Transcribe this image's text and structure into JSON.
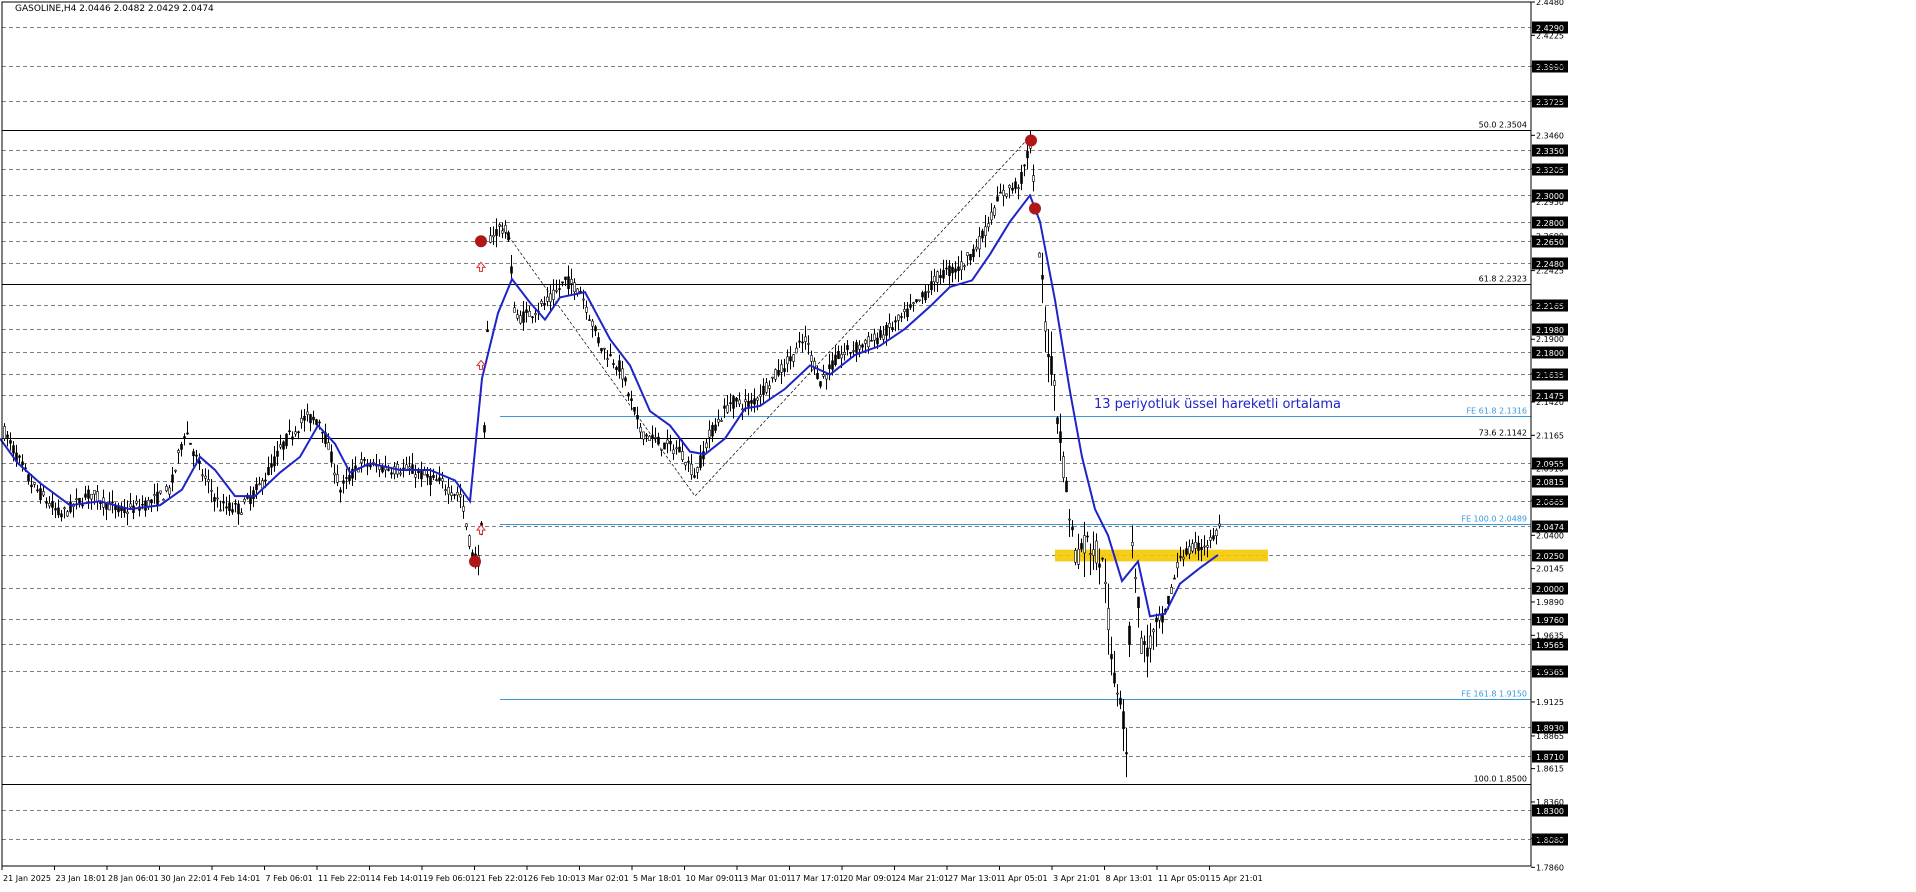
{
  "symbol_label": "GASOLINE,H4  2.0446 2.0482 2.0429 2.0474",
  "annotation_text": "13 periyotluk üssel hareketli ortalama",
  "colors": {
    "background": "#ffffff",
    "axis": "#000000",
    "grid_dashed": "#000000",
    "candle": "#000000",
    "ema": "#1f24c8",
    "fib_line": "#000000",
    "fe_line": "#3a9ad9",
    "marker_red": "#b01818",
    "arrow_red": "#e03030",
    "highlight": "#f5c800",
    "price_box": "#000000"
  },
  "chart_data": {
    "type": "candlestick",
    "title": "GASOLINE,H4",
    "ohlc_last": {
      "open": 2.0446,
      "high": 2.0482,
      "low": 2.0429,
      "close": 2.0474
    },
    "ylim": [
      1.787,
      2.448
    ],
    "x_tick_labels": [
      "21 Jan 2025",
      "23 Jan 18:01",
      "28 Jan 06:01",
      "30 Jan 22:01",
      "4 Feb 14:01",
      "7 Feb 06:01",
      "11 Feb 22:01",
      "14 Feb 14:01",
      "19 Feb 06:01",
      "21 Feb 22:01",
      "26 Feb 10:01",
      "3 Mar 02:01",
      "5 Mar 18:01",
      "10 Mar 09:01",
      "13 Mar 01:01",
      "17 Mar 17:01",
      "20 Mar 09:01",
      "24 Mar 21:01",
      "27 Mar 13:01",
      "1 Apr 05:01",
      "3 Apr 21:01",
      "8 Apr 13:01",
      "11 Apr 05:01",
      "15 Apr 21:01"
    ],
    "y_tick_labels": [
      "2.4480",
      "2.4225",
      "2.3990",
      "2.3725",
      "2.3460",
      "2.3205",
      "2.2950",
      "2.2690",
      "2.2425",
      "2.2165",
      "2.1900",
      "2.1635",
      "2.1420",
      "2.1165",
      "2.0910",
      "2.0665",
      "2.0400",
      "2.0145",
      "1.9890",
      "1.9635",
      "1.9375",
      "1.9125",
      "1.8865",
      "1.8615",
      "1.8360",
      "1.8080",
      "1.7860"
    ],
    "highlighted_levels": [
      "2.4290",
      "2.3990",
      "2.3725",
      "2.3350",
      "2.3205",
      "2.3000",
      "2.2800",
      "2.2650",
      "2.2480",
      "2.2165",
      "2.1980",
      "2.1800",
      "2.1635",
      "2.1475",
      "2.0955",
      "2.0815",
      "2.0665",
      "2.0474",
      "2.0250",
      "2.0000",
      "1.9760",
      "1.9565",
      "1.9365",
      "1.8930",
      "1.8710",
      "1.8300",
      "1.8080"
    ],
    "fibonacci_levels": [
      {
        "label": "50.0 2.3504",
        "value": 2.3504
      },
      {
        "label": "61.8 2.2323",
        "value": 2.2323
      },
      {
        "label": "73.6 2.1142",
        "value": 2.1142
      },
      {
        "label": "100.0 1.8500",
        "value": 1.85
      }
    ],
    "fibonacci_expansion_levels": [
      {
        "label": "FE 61.8 2.1316",
        "value": 2.1316
      },
      {
        "label": "FE 100.0 2.0489",
        "value": 2.0489
      },
      {
        "label": "FE 161.8 1.9150",
        "value": 1.915
      }
    ],
    "ema_period": 13,
    "ema_points": [
      [
        0,
        2.114
      ],
      [
        18,
        2.095
      ],
      [
        40,
        2.08
      ],
      [
        70,
        2.063
      ],
      [
        100,
        2.066
      ],
      [
        130,
        2.06
      ],
      [
        160,
        2.063
      ],
      [
        182,
        2.075
      ],
      [
        200,
        2.1
      ],
      [
        215,
        2.09
      ],
      [
        235,
        2.07
      ],
      [
        255,
        2.07
      ],
      [
        280,
        2.088
      ],
      [
        300,
        2.1
      ],
      [
        318,
        2.124
      ],
      [
        335,
        2.11
      ],
      [
        350,
        2.088
      ],
      [
        370,
        2.095
      ],
      [
        400,
        2.09
      ],
      [
        430,
        2.09
      ],
      [
        455,
        2.082
      ],
      [
        470,
        2.066
      ],
      [
        482,
        2.16
      ],
      [
        498,
        2.21
      ],
      [
        512,
        2.236
      ],
      [
        530,
        2.218
      ],
      [
        545,
        2.205
      ],
      [
        560,
        2.222
      ],
      [
        585,
        2.226
      ],
      [
        610,
        2.19
      ],
      [
        630,
        2.17
      ],
      [
        650,
        2.135
      ],
      [
        670,
        2.124
      ],
      [
        690,
        2.104
      ],
      [
        705,
        2.102
      ],
      [
        725,
        2.114
      ],
      [
        745,
        2.137
      ],
      [
        760,
        2.139
      ],
      [
        785,
        2.152
      ],
      [
        810,
        2.17
      ],
      [
        830,
        2.163
      ],
      [
        855,
        2.178
      ],
      [
        880,
        2.185
      ],
      [
        905,
        2.198
      ],
      [
        930,
        2.215
      ],
      [
        950,
        2.23
      ],
      [
        972,
        2.235
      ],
      [
        990,
        2.255
      ],
      [
        1010,
        2.28
      ],
      [
        1030,
        2.3
      ],
      [
        1040,
        2.28
      ],
      [
        1055,
        2.22
      ],
      [
        1070,
        2.15
      ],
      [
        1082,
        2.1
      ],
      [
        1095,
        2.06
      ],
      [
        1108,
        2.04
      ],
      [
        1122,
        2.005
      ],
      [
        1138,
        2.02
      ],
      [
        1150,
        1.978
      ],
      [
        1165,
        1.98
      ],
      [
        1180,
        2.003
      ],
      [
        1200,
        2.015
      ],
      [
        1218,
        2.025
      ]
    ],
    "price_points": [
      [
        0,
        2.125
      ],
      [
        30,
        2.08
      ],
      [
        60,
        2.055
      ],
      [
        90,
        2.072
      ],
      [
        120,
        2.058
      ],
      [
        150,
        2.065
      ],
      [
        170,
        2.075
      ],
      [
        185,
        2.122
      ],
      [
        200,
        2.09
      ],
      [
        220,
        2.062
      ],
      [
        240,
        2.06
      ],
      [
        260,
        2.078
      ],
      [
        285,
        2.112
      ],
      [
        305,
        2.13
      ],
      [
        320,
        2.128
      ],
      [
        340,
        2.075
      ],
      [
        360,
        2.095
      ],
      [
        380,
        2.092
      ],
      [
        410,
        2.09
      ],
      [
        440,
        2.08
      ],
      [
        460,
        2.07
      ],
      [
        472,
        2.025
      ],
      [
        480,
        2.02
      ],
      [
        490,
        2.268
      ],
      [
        500,
        2.276
      ],
      [
        508,
        2.27
      ],
      [
        515,
        2.205
      ],
      [
        530,
        2.21
      ],
      [
        550,
        2.22
      ],
      [
        565,
        2.235
      ],
      [
        580,
        2.228
      ],
      [
        600,
        2.185
      ],
      [
        620,
        2.168
      ],
      [
        640,
        2.12
      ],
      [
        660,
        2.11
      ],
      [
        680,
        2.105
      ],
      [
        695,
        2.086
      ],
      [
        710,
        2.118
      ],
      [
        730,
        2.142
      ],
      [
        750,
        2.14
      ],
      [
        770,
        2.158
      ],
      [
        790,
        2.175
      ],
      [
        805,
        2.19
      ],
      [
        820,
        2.158
      ],
      [
        840,
        2.178
      ],
      [
        860,
        2.185
      ],
      [
        880,
        2.192
      ],
      [
        900,
        2.205
      ],
      [
        920,
        2.22
      ],
      [
        940,
        2.24
      ],
      [
        960,
        2.245
      ],
      [
        980,
        2.265
      ],
      [
        1000,
        2.3
      ],
      [
        1020,
        2.31
      ],
      [
        1030,
        2.34
      ],
      [
        1036,
        2.285
      ],
      [
        1045,
        2.2
      ],
      [
        1055,
        2.15
      ],
      [
        1065,
        2.08
      ],
      [
        1075,
        2.025
      ],
      [
        1085,
        2.035
      ],
      [
        1095,
        2.03
      ],
      [
        1105,
        2.01
      ],
      [
        1112,
        1.93
      ],
      [
        1120,
        1.92
      ],
      [
        1126,
        1.88
      ],
      [
        1132,
        2.04
      ],
      [
        1142,
        1.95
      ],
      [
        1152,
        1.96
      ],
      [
        1165,
        1.98
      ],
      [
        1180,
        2.025
      ],
      [
        1195,
        2.03
      ],
      [
        1210,
        2.035
      ],
      [
        1220,
        2.047
      ]
    ],
    "signal_markers": [
      {
        "type": "dot",
        "x": 481,
        "value": 2.265
      },
      {
        "type": "dot",
        "x": 1031,
        "value": 2.342
      },
      {
        "type": "dot",
        "x": 1035,
        "value": 2.29
      },
      {
        "type": "dot",
        "x": 475,
        "value": 2.02
      },
      {
        "type": "arrow",
        "x": 481,
        "value": 2.245
      },
      {
        "type": "arrow",
        "x": 481,
        "value": 2.17
      },
      {
        "type": "arrow",
        "x": 481,
        "value": 2.044
      }
    ],
    "zigzag": [
      [
        500,
        2.278
      ],
      [
        695,
        2.07
      ],
      [
        1030,
        2.345
      ]
    ],
    "highlight_zone": {
      "x_start": 1055,
      "x_end": 1268,
      "upper": 2.029,
      "lower": 2.02
    },
    "grid": true
  }
}
